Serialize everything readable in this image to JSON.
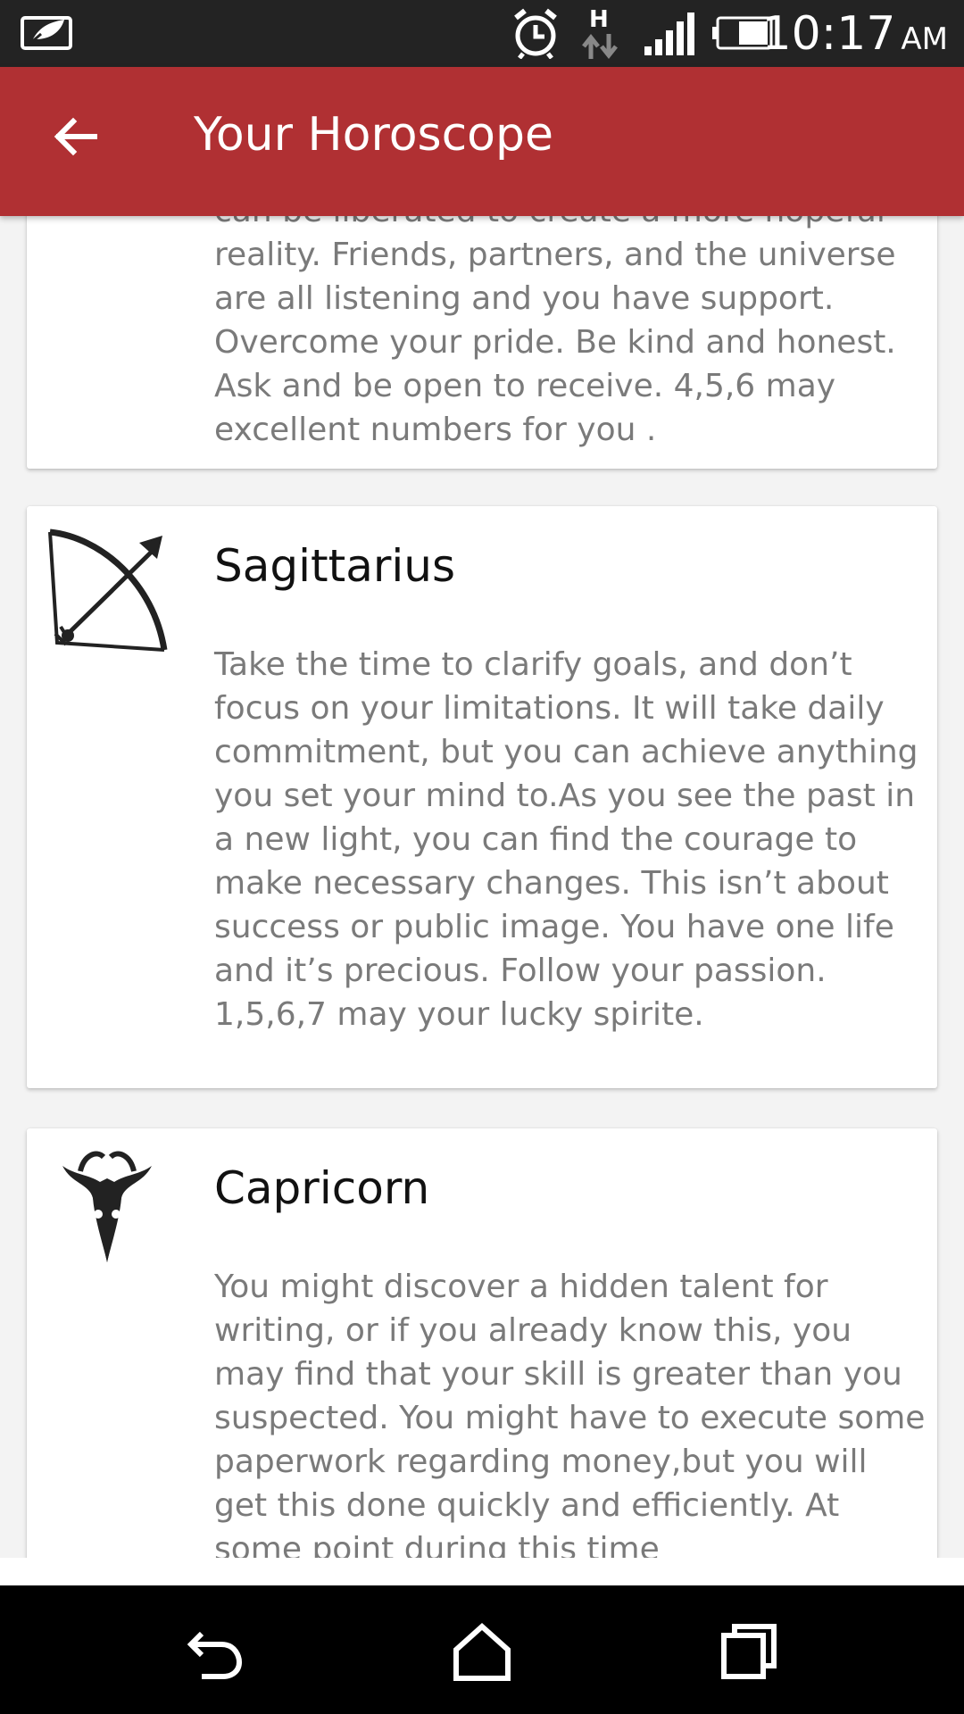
{
  "status_bar": {
    "time": "10:17",
    "ampm": "AM",
    "network_type": "H",
    "icons": [
      "notification-icon",
      "alarm-icon",
      "data-arrows-icon",
      "signal-icon",
      "battery-icon"
    ]
  },
  "toolbar": {
    "title": "Your Horoscope",
    "back_icon": "arrow-left-icon",
    "background_color": "#b03033"
  },
  "cards": [
    {
      "sign": "",
      "description": "can be liberated to create a more hopeful reality. Friends, partners, and the universe are all listening and you have support. Overcome your pride. Be kind and honest. Ask and be open to receive. 4,5,6 may excellent numbers  for you ."
    },
    {
      "sign": "Sagittarius",
      "icon": "sagittarius-bow-arrow-icon",
      "description": "Take the time to clarify goals, and don’t focus on your limitations.  It will take daily commitment, but you can achieve anything you set your mind to.As you see the past in a new light, you can find the courage to make necessary changes. This isn’t about success or public image. You have one life and it’s precious. Follow your passion. 1,5,6,7 may your lucky spirite."
    },
    {
      "sign": "Capricorn",
      "icon": "capricorn-goat-icon",
      "description": "You might discover a hidden talent for writing, or if you already know this, you may find that your skill is greater than you suspected. You might have to execute some paperwork regarding money,but you will get this done quickly and efficiently. At some point during this time"
    }
  ],
  "nav_bar": {
    "buttons": [
      "back-nav-icon",
      "home-nav-icon",
      "recents-nav-icon"
    ]
  }
}
